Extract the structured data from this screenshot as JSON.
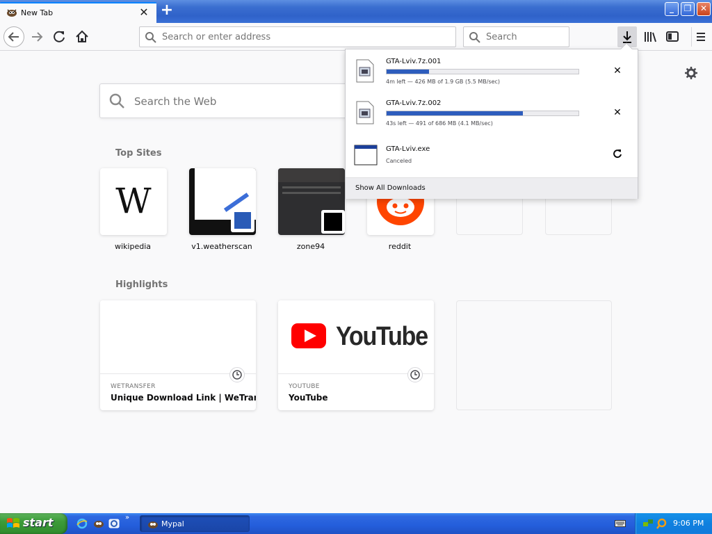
{
  "browser": {
    "tab": {
      "title": "New Tab"
    },
    "urlbar": {
      "placeholder": "Search or enter address"
    },
    "searchbar": {
      "placeholder": "Search"
    }
  },
  "newtab": {
    "search_placeholder": "Search the Web",
    "top_sites_title": "Top Sites",
    "top_sites": [
      {
        "label": "wikipedia"
      },
      {
        "label": "v1.weatherscan"
      },
      {
        "label": "zone94"
      },
      {
        "label": "reddit"
      },
      {
        "label": ""
      },
      {
        "label": ""
      }
    ],
    "highlights_title": "Highlights",
    "highlights": [
      {
        "source": "WETRANSFER",
        "title": "Unique Download Link | WeTran..."
      },
      {
        "source": "YOUTUBE",
        "title": "YouTube"
      }
    ],
    "youtube_logo_text": "YouTube",
    "wikipedia_logo_text": "W"
  },
  "downloads": {
    "items": [
      {
        "name": "GTA-Lviv.7z.001",
        "status": "4m left — 426 MB of 1.9 GB (5.5 MB/sec)",
        "progress": 0.22,
        "action": "cancel"
      },
      {
        "name": "GTA-Lviv.7z.002",
        "status": "43s left — 491 of 686 MB (4.1 MB/sec)",
        "progress": 0.71,
        "action": "cancel"
      },
      {
        "name": "GTA-Lviv.exe",
        "status": "Canceled",
        "action": "retry"
      }
    ],
    "show_all_label": "Show All Downloads"
  },
  "taskbar": {
    "start_label": "start",
    "task_label": "Mypal",
    "clock": "9:06 PM",
    "quick_launch_more": "»"
  },
  "colors": {
    "accent": "#0a84ff",
    "progress": "#2e5dbd",
    "xp_blue": "#245edb",
    "xp_green": "#3c9b39",
    "youtube_red": "#ff0000",
    "reddit_orange": "#ff4500"
  }
}
